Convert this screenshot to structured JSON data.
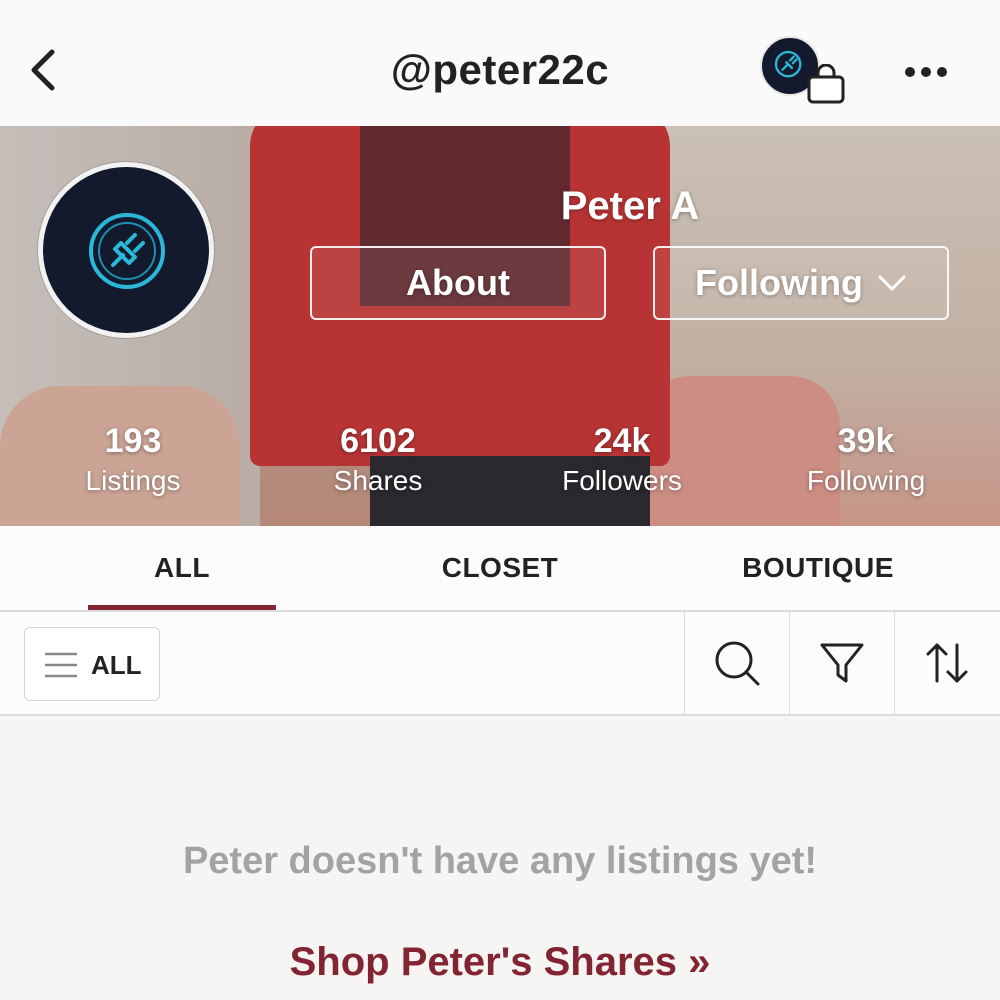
{
  "header": {
    "title": "@peter22c",
    "back_icon": "chevron-left-icon",
    "bundle_icon": "shopping-bag-icon",
    "more_icon": "more-horizontal-icon"
  },
  "profile": {
    "name": "Peter A",
    "about_label": "About",
    "following_label": "Following",
    "avatar_icon": "plug-icon"
  },
  "stats": [
    {
      "value": "193",
      "label": "Listings"
    },
    {
      "value": "6102",
      "label": "Shares"
    },
    {
      "value": "24k",
      "label": "Followers"
    },
    {
      "value": "39k",
      "label": "Following"
    }
  ],
  "tabs": [
    {
      "label": "ALL",
      "active": true
    },
    {
      "label": "CLOSET",
      "active": false
    },
    {
      "label": "BOUTIQUE",
      "active": false
    }
  ],
  "filter": {
    "all_label": "ALL",
    "tools": [
      "search-icon",
      "filter-icon",
      "sort-icon"
    ]
  },
  "empty_state": {
    "message": "Peter doesn't have any listings yet!",
    "link": "Shop Peter's Shares »"
  },
  "colors": {
    "accent": "#822432",
    "avatar_bg": "#141a2e",
    "avatar_icon": "#2bb8d8",
    "muted_text": "#a3a3a3"
  }
}
